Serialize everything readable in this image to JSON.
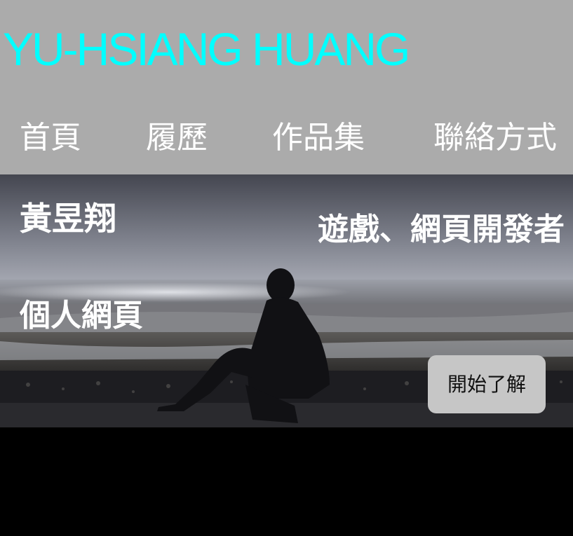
{
  "header": {
    "title": "YU-HSIANG HUANG",
    "title_color": "#00ffff",
    "background_color": "#ababab"
  },
  "nav": {
    "items": [
      {
        "label": "首頁"
      },
      {
        "label": "履歷"
      },
      {
        "label": "作品集"
      },
      {
        "label": "聯絡方式"
      }
    ]
  },
  "hero": {
    "name": "黃昱翔",
    "subtitle": "個人網頁",
    "role": "遊戲、網頁開發者",
    "cta_label": "開始了解",
    "image_description_icon": "beach-silhouette-photo"
  }
}
